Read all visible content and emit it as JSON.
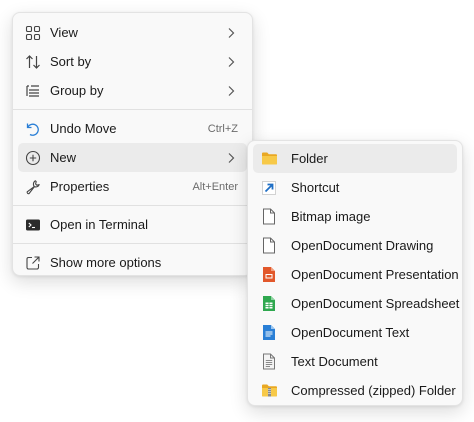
{
  "main_menu": {
    "items": [
      {
        "label": "View",
        "icon": "view-grid-icon",
        "submenu": true
      },
      {
        "label": "Sort by",
        "icon": "sort-arrows-icon",
        "submenu": true
      },
      {
        "label": "Group by",
        "icon": "group-list-icon",
        "submenu": true
      },
      {
        "label": "Undo Move",
        "icon": "undo-icon",
        "shortcut": "Ctrl+Z"
      },
      {
        "label": "New",
        "icon": "plus-circle-icon",
        "submenu": true,
        "hovered": true
      },
      {
        "label": "Properties",
        "icon": "wrench-icon",
        "shortcut": "Alt+Enter"
      },
      {
        "label": "Open in Terminal",
        "icon": "terminal-icon"
      },
      {
        "label": "Show more options",
        "icon": "share-out-icon"
      }
    ]
  },
  "new_submenu": {
    "items": [
      {
        "label": "Folder",
        "icon": "folder-icon",
        "hovered": true
      },
      {
        "label": "Shortcut",
        "icon": "shortcut-arrow-icon"
      },
      {
        "label": "Bitmap image",
        "icon": "blank-document-icon"
      },
      {
        "label": "OpenDocument Drawing",
        "icon": "blank-document-icon"
      },
      {
        "label": "OpenDocument Presentation",
        "icon": "presentation-document-icon"
      },
      {
        "label": "OpenDocument Spreadsheet",
        "icon": "spreadsheet-document-icon"
      },
      {
        "label": "OpenDocument Text",
        "icon": "text-document-blue-icon"
      },
      {
        "label": "Text Document",
        "icon": "text-document-icon"
      },
      {
        "label": "Compressed (zipped) Folder",
        "icon": "zip-folder-icon"
      }
    ]
  },
  "colors": {
    "menu_bg": "#f9f9f9",
    "hover_bg": "#ebebeb",
    "folder": "#f4c542",
    "presentation": "#e2582b",
    "spreadsheet": "#2fa84f",
    "text_blue": "#2a7fd6",
    "shortcut_blue": "#1f6fc5"
  }
}
